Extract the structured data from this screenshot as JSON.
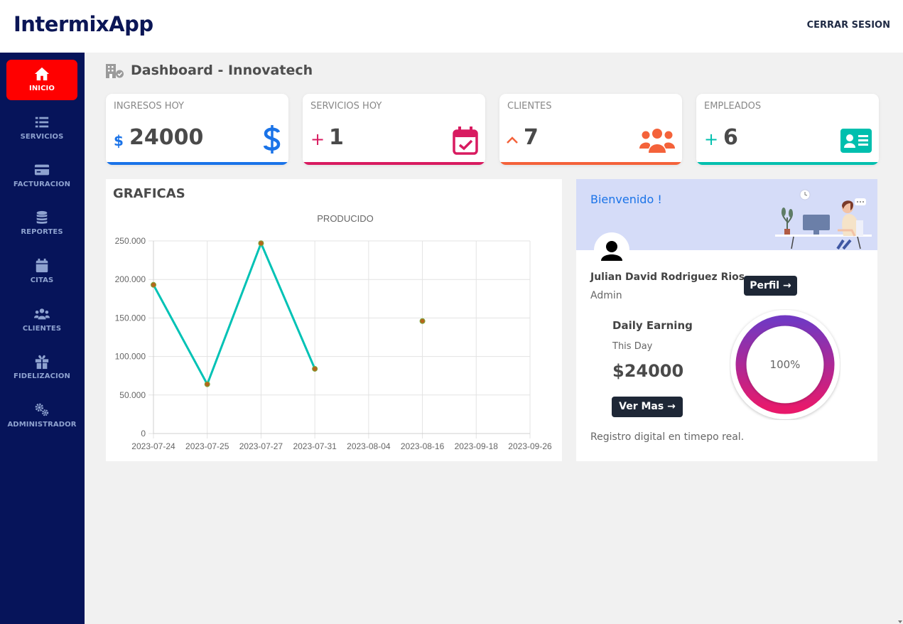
{
  "app": {
    "title": "IntermixApp",
    "logout_label": "CERRAR SESION"
  },
  "sidebar": {
    "items": [
      {
        "label": "INICIO",
        "icon": "home-icon",
        "active": true
      },
      {
        "label": "SERVICIOS",
        "icon": "list-icon"
      },
      {
        "label": "FACTURACION",
        "icon": "credit-card-icon"
      },
      {
        "label": "REPORTES",
        "icon": "coins-icon"
      },
      {
        "label": "CITAS",
        "icon": "calendar-icon"
      },
      {
        "label": "CLIENTES",
        "icon": "users-icon"
      },
      {
        "label": "FIDELIZACION",
        "icon": "gift-icon"
      },
      {
        "label": "ADMINISTRADOR",
        "icon": "cogs-icon"
      }
    ]
  },
  "page": {
    "title": "Dashboard - Innovatech",
    "icon": "building-icon"
  },
  "cards": [
    {
      "label": "INGRESOS HOY",
      "prefix": "$",
      "value": "24000",
      "icon": "dollar-icon",
      "color": "#1a73e8"
    },
    {
      "label": "SERVICIOS HOY",
      "prefix": "+",
      "value": "1",
      "icon": "calendar-check-icon",
      "color": "#d81b60"
    },
    {
      "label": "CLIENTES",
      "prefix": "^",
      "value": "7",
      "icon": "users-icon",
      "color": "#f4623a"
    },
    {
      "label": "EMPLEADOS",
      "prefix": "+",
      "value": "6",
      "icon": "id-card-icon",
      "color": "#00bfae"
    }
  ],
  "chart_panel": {
    "heading": "GRAFICAS"
  },
  "chart_data": {
    "type": "line",
    "title": "PRODUCIDO",
    "xlabel": "",
    "ylabel": "",
    "categories": [
      "2023-07-24",
      "2023-07-25",
      "2023-07-27",
      "2023-07-31",
      "2023-08-04",
      "2023-08-16",
      "2023-09-18",
      "2023-09-26"
    ],
    "series": [
      {
        "values": [
          193000,
          64000,
          247000,
          84000,
          null,
          146000,
          null,
          null
        ]
      }
    ],
    "y_ticks": [
      "0",
      "50.000",
      "100.000",
      "150.000",
      "200.000",
      "250.000"
    ],
    "ylim": [
      0,
      250000
    ],
    "grid": true,
    "line_color": "#00c2b5",
    "point_color": "#b5651d"
  },
  "welcome": {
    "greeting": "Bienvenido !",
    "user_name": "Julian David Rodriguez Rios",
    "role": "Admin",
    "profile_label": "Perfil →",
    "earning_title": "Daily Earning",
    "earning_subtitle": "This Day",
    "earning_amount": "$24000",
    "more_label": "Ver Mas →",
    "progress": 100,
    "progress_label": "100%",
    "footnote": "Registro digital en timepo real."
  }
}
